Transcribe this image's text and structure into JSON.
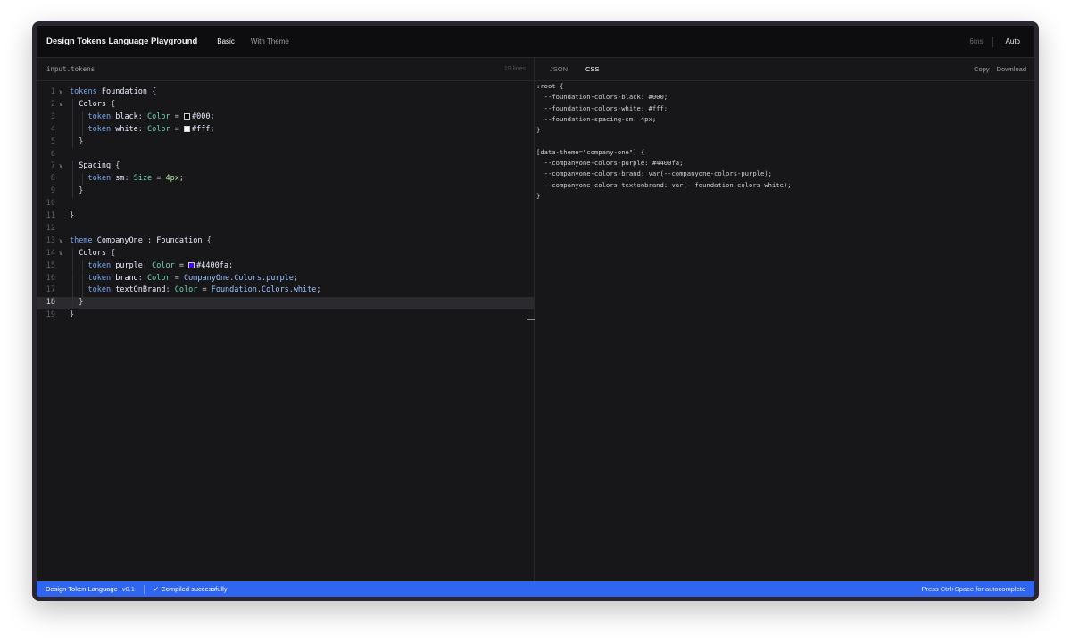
{
  "app": {
    "title": "Design Tokens Language Playground",
    "tabs": [
      "Basic",
      "With Theme"
    ],
    "active_tab": "Basic",
    "timing": "6ms",
    "auto_label": "Auto"
  },
  "editor": {
    "file_name": "input.tokens",
    "line_count": "19 lines",
    "current_line": 18,
    "lines": [
      {
        "n": "1",
        "fold": true,
        "indent": 0
      },
      {
        "n": "2",
        "fold": true,
        "indent": 1
      },
      {
        "n": "3",
        "fold": false,
        "indent": 2
      },
      {
        "n": "4",
        "fold": false,
        "indent": 2
      },
      {
        "n": "5",
        "fold": false,
        "indent": 1
      },
      {
        "n": "6",
        "fold": false,
        "indent": 0
      },
      {
        "n": "7",
        "fold": true,
        "indent": 1
      },
      {
        "n": "8",
        "fold": false,
        "indent": 2
      },
      {
        "n": "9",
        "fold": false,
        "indent": 1
      },
      {
        "n": "10",
        "fold": false,
        "indent": 0
      },
      {
        "n": "11",
        "fold": false,
        "indent": 0
      },
      {
        "n": "12",
        "fold": false,
        "indent": 0
      },
      {
        "n": "13",
        "fold": true,
        "indent": 0
      },
      {
        "n": "14",
        "fold": true,
        "indent": 1
      },
      {
        "n": "15",
        "fold": false,
        "indent": 2
      },
      {
        "n": "16",
        "fold": false,
        "indent": 2
      },
      {
        "n": "17",
        "fold": false,
        "indent": 2
      },
      {
        "n": "18",
        "fold": false,
        "indent": 1
      },
      {
        "n": "19",
        "fold": false,
        "indent": 0
      }
    ],
    "tokens": [
      [
        [
          "kw",
          "tokens"
        ],
        [
          "plain",
          " "
        ],
        [
          "id",
          "Foundation"
        ],
        [
          "punc",
          " {"
        ]
      ],
      [
        [
          "plain",
          "  "
        ],
        [
          "id",
          "Colors"
        ],
        [
          "punc",
          " {"
        ]
      ],
      [
        [
          "plain",
          "    "
        ],
        [
          "kw",
          "token"
        ],
        [
          "plain",
          " "
        ],
        [
          "id",
          "black"
        ],
        [
          "punc",
          ": "
        ],
        [
          "typ",
          "Color"
        ],
        [
          "punc",
          " = "
        ],
        [
          "swatch",
          "#000000"
        ],
        [
          "hex",
          "#000"
        ],
        [
          "punc",
          ";"
        ]
      ],
      [
        [
          "plain",
          "    "
        ],
        [
          "kw",
          "token"
        ],
        [
          "plain",
          " "
        ],
        [
          "id",
          "white"
        ],
        [
          "punc",
          ": "
        ],
        [
          "typ",
          "Color"
        ],
        [
          "punc",
          " = "
        ],
        [
          "swatch",
          "#ffffff"
        ],
        [
          "hex",
          "#fff"
        ],
        [
          "punc",
          ";"
        ]
      ],
      [
        [
          "punc",
          "  }"
        ]
      ],
      [],
      [
        [
          "plain",
          "  "
        ],
        [
          "id",
          "Spacing"
        ],
        [
          "punc",
          " {"
        ]
      ],
      [
        [
          "plain",
          "    "
        ],
        [
          "kw",
          "token"
        ],
        [
          "plain",
          " "
        ],
        [
          "id",
          "sm"
        ],
        [
          "punc",
          ": "
        ],
        [
          "typ",
          "Size"
        ],
        [
          "punc",
          " = "
        ],
        [
          "num",
          "4px"
        ],
        [
          "punc",
          ";"
        ]
      ],
      [
        [
          "punc",
          "  }"
        ]
      ],
      [],
      [
        [
          "punc",
          "}"
        ]
      ],
      [],
      [
        [
          "kw",
          "theme"
        ],
        [
          "plain",
          " "
        ],
        [
          "id",
          "CompanyOne"
        ],
        [
          "punc",
          " : "
        ],
        [
          "id",
          "Foundation"
        ],
        [
          "punc",
          " {"
        ]
      ],
      [
        [
          "plain",
          "  "
        ],
        [
          "id",
          "Colors"
        ],
        [
          "punc",
          " {"
        ]
      ],
      [
        [
          "plain",
          "    "
        ],
        [
          "kw",
          "token"
        ],
        [
          "plain",
          " "
        ],
        [
          "id",
          "purple"
        ],
        [
          "punc",
          ": "
        ],
        [
          "typ",
          "Color"
        ],
        [
          "punc",
          " = "
        ],
        [
          "swatch",
          "#4400fa"
        ],
        [
          "hex",
          "#4400fa"
        ],
        [
          "punc",
          ";"
        ]
      ],
      [
        [
          "plain",
          "    "
        ],
        [
          "kw",
          "token"
        ],
        [
          "plain",
          " "
        ],
        [
          "id",
          "brand"
        ],
        [
          "punc",
          ": "
        ],
        [
          "typ",
          "Color"
        ],
        [
          "punc",
          " = "
        ],
        [
          "ref",
          "CompanyOne.Colors.purple"
        ],
        [
          "punc",
          ";"
        ]
      ],
      [
        [
          "plain",
          "    "
        ],
        [
          "kw",
          "token"
        ],
        [
          "plain",
          " "
        ],
        [
          "id",
          "textOnBrand"
        ],
        [
          "punc",
          ": "
        ],
        [
          "typ",
          "Color"
        ],
        [
          "punc",
          " = "
        ],
        [
          "ref",
          "Foundation.Colors.white"
        ],
        [
          "punc",
          ";"
        ]
      ],
      [
        [
          "punc",
          "  }"
        ]
      ],
      [
        [
          "punc",
          "}"
        ]
      ]
    ]
  },
  "output": {
    "tabs": [
      "JSON",
      "CSS"
    ],
    "active_tab": "CSS",
    "copy_label": "Copy",
    "download_label": "Download",
    "css_lines": [
      ":root {",
      "  --foundation-colors-black: #000;",
      "  --foundation-colors-white: #fff;",
      "  --foundation-spacing-sm: 4px;",
      "}",
      "",
      "[data-theme=\"company-one\"] {",
      "  --companyone-colors-purple: #4400fa;",
      "  --companyone-colors-brand: var(--companyone-colors-purple);",
      "  --companyone-colors-textonbrand: var(--foundation-colors-white);",
      "}"
    ]
  },
  "status": {
    "name": "Design Token Language",
    "version": "v0.1",
    "compile": "✓  Compiled successfully",
    "hint": "Press Ctrl+Space for autocomplete"
  },
  "colors": {
    "accent": "#2f65f0",
    "keyword": "#7aa6f0",
    "type": "#6fd4b5",
    "number": "#b7e5a0"
  }
}
